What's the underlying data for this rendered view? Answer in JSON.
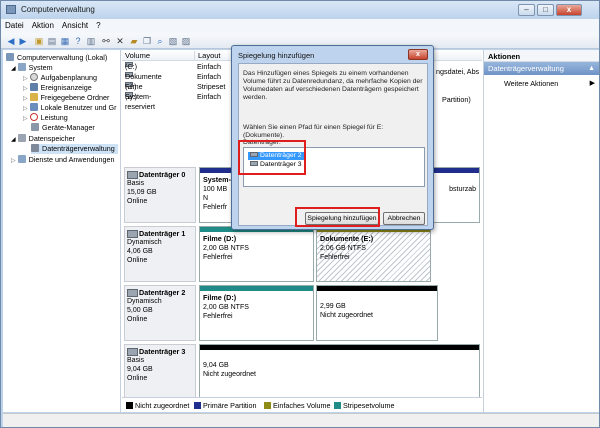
{
  "window": {
    "title": "Computerverwaltung",
    "buttons": {
      "min": "–",
      "max": "□",
      "close": "x"
    }
  },
  "menu": [
    "Datei",
    "Aktion",
    "Ansicht",
    "?"
  ],
  "tree": {
    "root": "Computerverwaltung (Lokal)",
    "system": "System",
    "items": [
      "Aufgabenplanung",
      "Ereignisanzeige",
      "Freigegebene Ordner",
      "Lokale Benutzer und Gr",
      "Leistung",
      "Geräte-Manager"
    ],
    "storage": "Datenspeicher",
    "disk_mgmt": "Datenträgerverwaltung",
    "services": "Dienste und Anwendungen"
  },
  "volumes": {
    "headers": {
      "volume": "Volume",
      "layout": "Layout"
    },
    "rows": [
      {
        "name": "(C:)",
        "layout": "Einfach"
      },
      {
        "name": "Dokumente (E:)",
        "layout": "Einfach"
      },
      {
        "name": "Filme (D:)",
        "layout": "Stripeset"
      },
      {
        "name": "System-reserviert",
        "layout": "Einfach"
      }
    ],
    "right_fragments": [
      "ngsdatei, Abs",
      "Partition)"
    ]
  },
  "disks": [
    {
      "name": "Datenträger 0",
      "type": "Basis",
      "size": "15,09 GB",
      "status": "Online",
      "parts": [
        {
          "title": "System-",
          "size": "100 MB N",
          "status": "Fehlerfr"
        },
        {
          "title": "",
          "size": "",
          "status": "bsturzab"
        }
      ]
    },
    {
      "name": "Datenträger 1",
      "type": "Dynamisch",
      "size": "4,06 GB",
      "status": "Online",
      "parts": [
        {
          "title": "Filme  (D:)",
          "size": "2,00 GB NTFS",
          "status": "Fehlerfrei"
        },
        {
          "title": "Dokumente  (E:)",
          "size": "2,06 GB NTFS",
          "status": "Fehlerfrei"
        }
      ]
    },
    {
      "name": "Datenträger 2",
      "type": "Dynamisch",
      "size": "5,00 GB",
      "status": "Online",
      "parts": [
        {
          "title": "Filme  (D:)",
          "size": "2,00 GB NTFS",
          "status": "Fehlerfrei"
        },
        {
          "title": "",
          "size": "2,99 GB",
          "status": "Nicht zugeordnet"
        }
      ]
    },
    {
      "name": "Datenträger 3",
      "type": "Basis",
      "size": "9,04 GB",
      "status": "Online",
      "parts": [
        {
          "title": "",
          "size": "9,04 GB",
          "status": "Nicht zugeordnet"
        }
      ]
    }
  ],
  "legend": [
    {
      "label": "Nicht zugeordnet",
      "color": "#000000"
    },
    {
      "label": "Primäre Partition",
      "color": "#1f2e8c"
    },
    {
      "label": "Einfaches Volume",
      "color": "#8e8c16"
    },
    {
      "label": "Stripesetvolume",
      "color": "#1f8c87"
    }
  ],
  "actions": {
    "header": "Aktionen",
    "sub": "Datenträgerverwaltung",
    "more": "Weitere Aktionen"
  },
  "dialog": {
    "title": "Spiegelung hinzufügen",
    "close": "x",
    "text1": "Das Hinzufügen eines Spiegels zu einem vorhandenen Volume führt zu Datenredundanz, da mehrfache Kopien der Volumedaten auf verschiedenen Datenträgern gespeichert werden.",
    "text2": "Wählen Sie einen Pfad für einen Spiegel für E: (Dokumente).",
    "list_label": "Datenträger:",
    "list": [
      "Datenträger 2",
      "Datenträger 3"
    ],
    "ok": "Spiegelung hinzufügen",
    "cancel": "Abbrechen"
  }
}
